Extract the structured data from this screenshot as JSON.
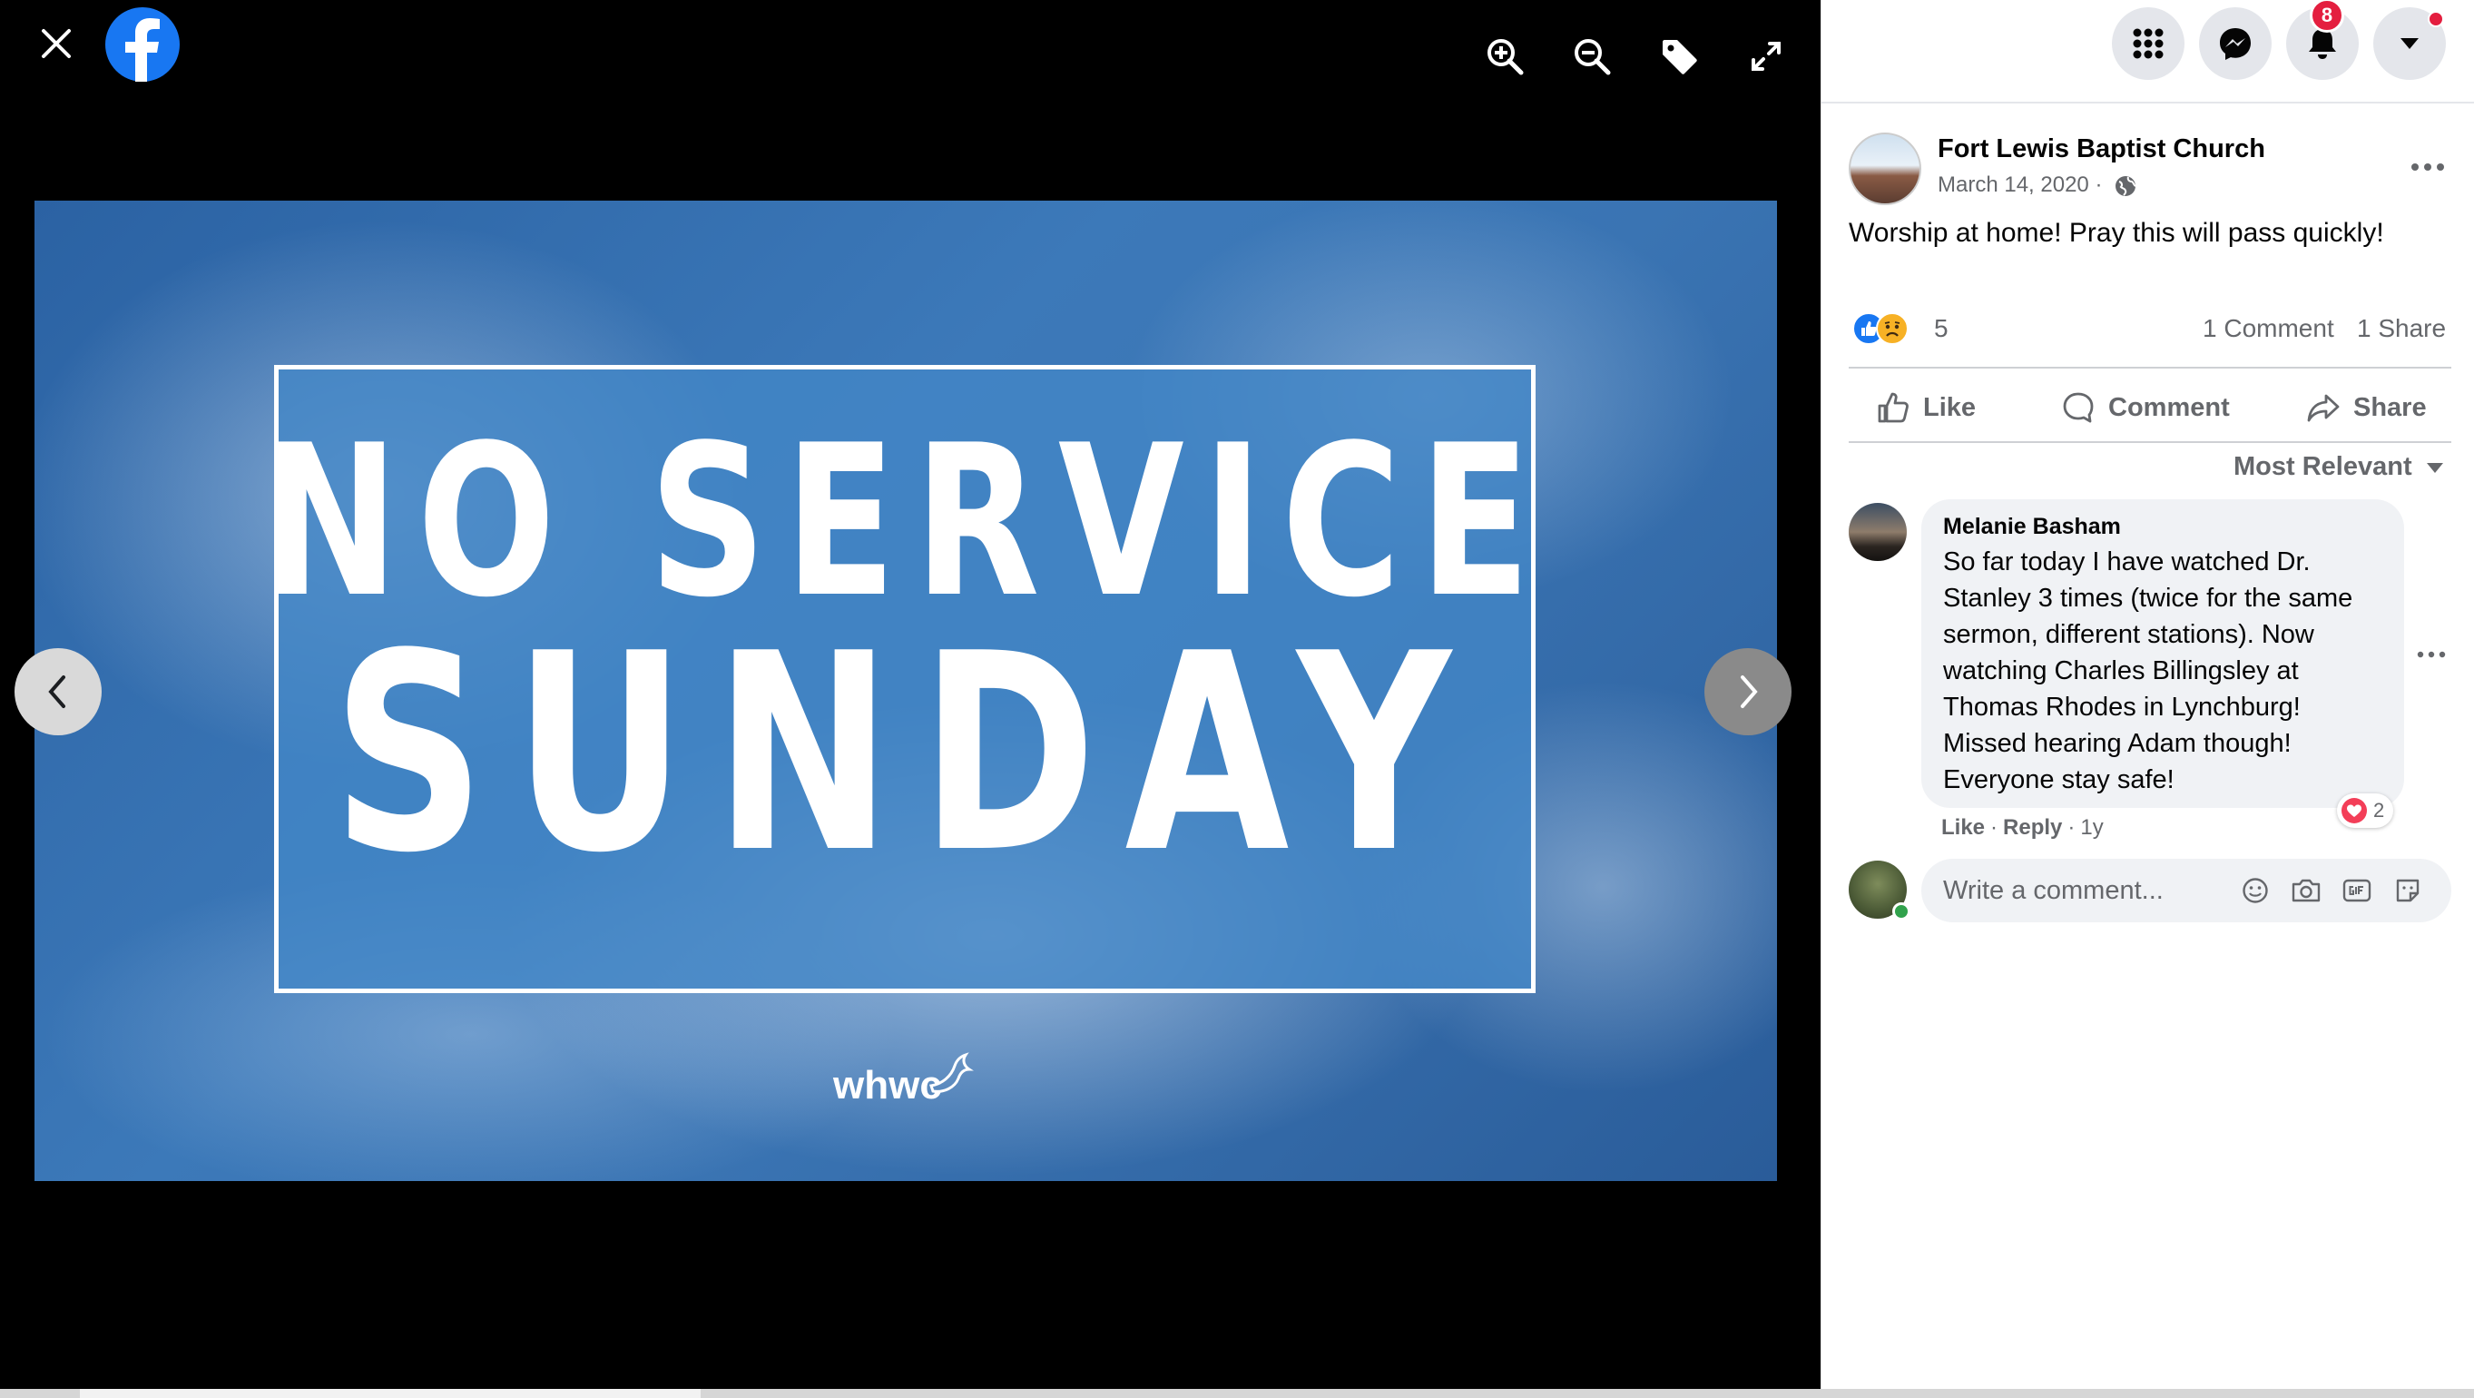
{
  "viewer": {
    "photo": {
      "headline_line1": "NO SERVICE",
      "headline_line2": "SUNDAY",
      "logo_text": "whwc"
    }
  },
  "nav": {
    "notification_count": "8"
  },
  "post": {
    "page_name": "Fort Lewis Baptist Church",
    "date": "March 14, 2020 ·",
    "text": "Worship at home! Pray this will pass quickly!",
    "reaction_count": "5",
    "comment_count": "1 Comment",
    "share_count": "1 Share",
    "actions": {
      "like": "Like",
      "comment": "Comment",
      "share": "Share"
    },
    "sort_label": "Most Relevant"
  },
  "comments": [
    {
      "author": "Melanie Basham",
      "text": "So far today I have watched Dr.\nStanley 3 times (twice for the same\nsermon, different stations). Now\nwatching Charles Billingsley at\nThomas Rhodes in Lynchburg!\nMissed hearing Adam though!\nEveryone stay safe!",
      "like_label": "Like",
      "reply_label": "Reply",
      "age": "1y",
      "reaction_count": "2"
    }
  ],
  "composer": {
    "placeholder": "Write a comment..."
  },
  "colors": {
    "brand": "#1877f2",
    "badge": "#e41e3f",
    "secondary_text": "#65676b"
  }
}
